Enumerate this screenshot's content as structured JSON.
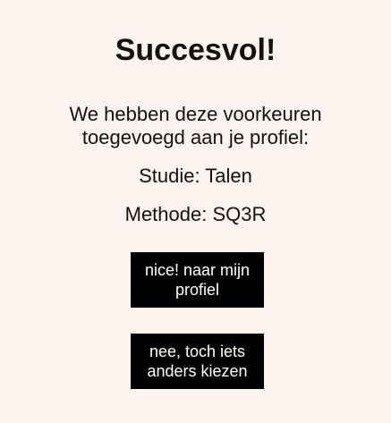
{
  "success": {
    "title": "Succesvol!",
    "message": "We hebben deze voorkeuren toegevoegd aan je profiel:",
    "preferences": {
      "study": "Studie: Talen",
      "method": "Methode: SQ3R"
    },
    "buttons": {
      "profile": "nice! naar mijn profiel",
      "change": "nee, toch iets anders kiezen"
    }
  },
  "colors": {
    "background": "#fdf3ef",
    "button_bg": "#000000",
    "button_text": "#ffffff"
  }
}
